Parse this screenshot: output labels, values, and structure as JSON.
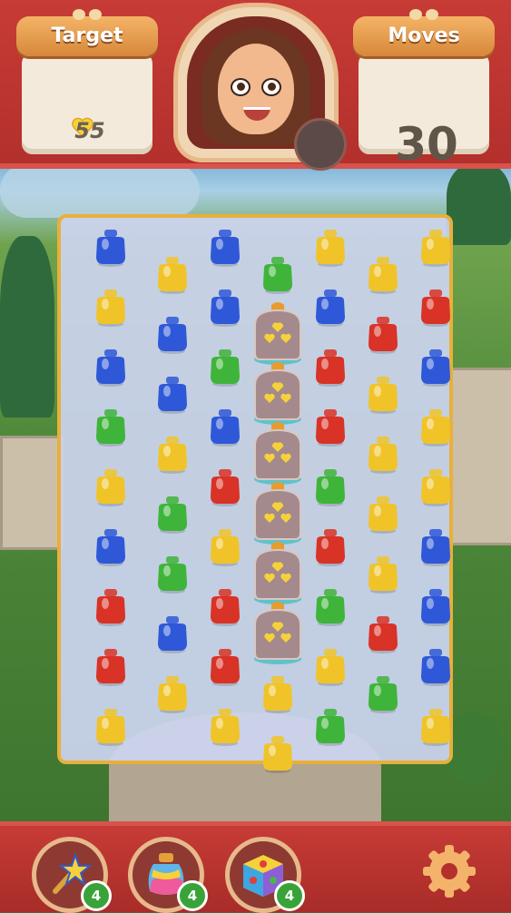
{
  "header": {
    "target_label": "Target",
    "target_value": "55",
    "moves_label": "Moves",
    "moves_value": "30"
  },
  "boosters": [
    {
      "icon": "magic-wand-icon",
      "count": "4"
    },
    {
      "icon": "rainbow-potion-icon",
      "count": "4"
    },
    {
      "icon": "color-cube-icon",
      "count": "4"
    }
  ],
  "settings_icon": "gear-icon",
  "colors": {
    "blue": "#2f58d8",
    "yellow": "#f0c428",
    "green": "#3fb43a",
    "red": "#d93226",
    "accent": "#e8b03a",
    "header": "#c73b36"
  },
  "board": {
    "columns": [
      [
        "blue",
        "yellow",
        "blue",
        "green",
        "yellow",
        "blue",
        "red",
        "red",
        "yellow"
      ],
      [
        "yellow",
        "blue",
        "blue",
        "yellow",
        "green",
        "green",
        "blue",
        "yellow"
      ],
      [
        "blue",
        "blue",
        "green",
        "blue",
        "red",
        "yellow",
        "red",
        "red",
        "yellow"
      ],
      [
        "green",
        "jar",
        "jar",
        "jar",
        "jar",
        "jar",
        "jar",
        "yellow",
        "yellow"
      ],
      [
        "yellow",
        "blue",
        "red",
        "red",
        "green",
        "red",
        "green",
        "yellow",
        "green"
      ],
      [
        "yellow",
        "red",
        "yellow",
        "yellow",
        "yellow",
        "yellow",
        "red",
        "green"
      ],
      [
        "yellow",
        "red",
        "blue",
        "yellow",
        "yellow",
        "blue",
        "blue",
        "blue",
        "yellow"
      ]
    ],
    "jar_target": "heart-jar"
  }
}
